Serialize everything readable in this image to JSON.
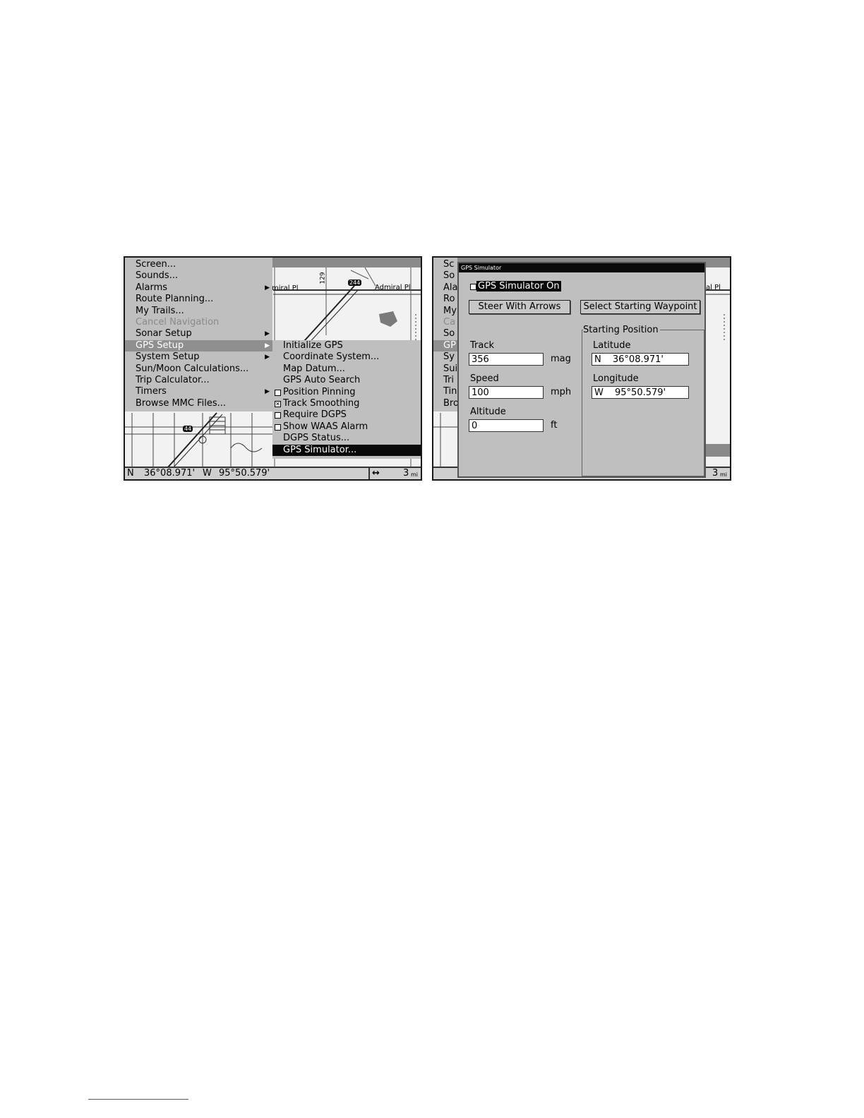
{
  "left_screen": {
    "main_menu": [
      {
        "label": "Screen...",
        "arrow": false,
        "state": "normal"
      },
      {
        "label": "Sounds...",
        "arrow": false,
        "state": "normal"
      },
      {
        "label": "Alarms",
        "arrow": true,
        "state": "normal"
      },
      {
        "label": "Route Planning...",
        "arrow": false,
        "state": "normal"
      },
      {
        "label": "My Trails...",
        "arrow": false,
        "state": "normal"
      },
      {
        "label": "Cancel Navigation",
        "arrow": false,
        "state": "disabled"
      },
      {
        "label": "Sonar Setup",
        "arrow": true,
        "state": "normal"
      },
      {
        "label": "GPS Setup",
        "arrow": true,
        "state": "highlighted"
      },
      {
        "label": "System Setup",
        "arrow": true,
        "state": "normal"
      },
      {
        "label": "Sun/Moon Calculations...",
        "arrow": false,
        "state": "normal"
      },
      {
        "label": "Trip Calculator...",
        "arrow": false,
        "state": "normal"
      },
      {
        "label": "Timers",
        "arrow": true,
        "state": "normal"
      },
      {
        "label": "Browse MMC Files...",
        "arrow": false,
        "state": "normal"
      }
    ],
    "gps_submenu": [
      {
        "label": "Initialize GPS",
        "checkbox": null,
        "state": "normal"
      },
      {
        "label": "Coordinate System...",
        "checkbox": null,
        "state": "normal"
      },
      {
        "label": "Map Datum...",
        "checkbox": null,
        "state": "normal"
      },
      {
        "label": "GPS Auto Search",
        "checkbox": null,
        "state": "normal"
      },
      {
        "label": "Position Pinning",
        "checkbox": false,
        "state": "normal"
      },
      {
        "label": "Track Smoothing",
        "checkbox": true,
        "state": "normal"
      },
      {
        "label": "Require DGPS",
        "checkbox": false,
        "state": "normal"
      },
      {
        "label": "Show WAAS Alarm",
        "checkbox": false,
        "state": "normal"
      },
      {
        "label": "DGPS Status...",
        "checkbox": null,
        "state": "normal"
      },
      {
        "label": "GPS Simulator...",
        "checkbox": null,
        "state": "selected"
      }
    ],
    "map_labels": {
      "street_1": "Admiral Pl",
      "street_2": "miral Pl",
      "highway_shield": "244",
      "route_number": "129",
      "interstate": "44"
    },
    "status_bar": {
      "lat_hemi": "N",
      "lat": "36°08.971'",
      "lon_hemi": "W",
      "lon": "95°50.579'",
      "zoom_icon": "↔",
      "zoom": "3",
      "zoom_unit": "mi"
    }
  },
  "right_screen": {
    "background_menu_fragments": [
      "Sc",
      "So",
      "Ala",
      "Ro",
      "My",
      "Ca",
      "So",
      "GP",
      "Sy",
      "Sui",
      "Tri",
      "Tin",
      "Bro"
    ],
    "map_label_fragment": "al Pl",
    "status_bar": {
      "zoom": "3",
      "zoom_unit": "mi"
    },
    "dialog": {
      "title": "GPS Simulator",
      "simulator_on_label": "GPS Simulator On",
      "simulator_on_checked": false,
      "steer_button": "Steer With Arrows",
      "select_waypoint_button": "Select Starting Waypoint",
      "track_label": "Track",
      "track_value": "356",
      "track_unit": "mag",
      "speed_label": "Speed",
      "speed_value": "100",
      "speed_unit": "mph",
      "altitude_label": "Altitude",
      "altitude_value": "0",
      "altitude_unit": "ft",
      "starting_position_label": "Starting Position",
      "latitude_label": "Latitude",
      "latitude_hemi": "N",
      "latitude_value": "36°08.971'",
      "longitude_label": "Longitude",
      "longitude_hemi": "W",
      "longitude_value": "95°50.579'"
    }
  }
}
